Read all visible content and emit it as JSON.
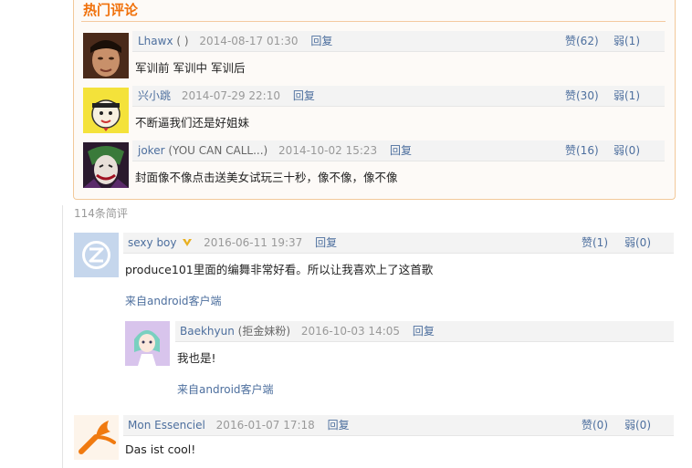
{
  "hot": {
    "title": "热门评论",
    "comments": [
      {
        "user": "Lhawx",
        "extra": "( )",
        "time": "2014-08-17 01:30",
        "reply": "回复",
        "up": "赞(62)",
        "down": "弱(1)",
        "text": "军训前 军训中 军训后"
      },
      {
        "user": "兴小跳",
        "extra": "",
        "time": "2014-07-29 22:10",
        "reply": "回复",
        "up": "赞(30)",
        "down": "弱(1)",
        "text": "不断逼我们还是好姐妹"
      },
      {
        "user": "joker",
        "extra": "(YOU CAN CALL...)",
        "time": "2014-10-02 15:23",
        "reply": "回复",
        "up": "赞(16)",
        "down": "弱(0)",
        "text": "封面像不像点击送美女试玩三十秒，像不像，像不像"
      }
    ]
  },
  "list": {
    "count_label": "114条简评",
    "comments": [
      {
        "user": "sexy boy",
        "time": "2016-06-11 19:37",
        "reply": "回复",
        "up": "赞(1)",
        "down": "弱(0)",
        "text": "produce101里面的编舞非常好看。所以让我喜欢上了这首歌",
        "from": "来自android客户端"
      },
      {
        "user": "Baekhyun",
        "extra": "(拒金妹粉)",
        "time": "2016-10-03 14:05",
        "reply": "回复",
        "text": "我也是!",
        "from": "来自android客户端"
      },
      {
        "user": "Mon Essenciel",
        "time": "2016-01-07 17:18",
        "reply": "回复",
        "up": "赞(0)",
        "down": "弱(0)",
        "text": "Das ist cool!"
      }
    ]
  },
  "colors": {
    "accent": "#f0700a",
    "link": "#4d6f9e",
    "vip": "#e8b020"
  },
  "icons": {
    "vip_badge": "vip-badge-icon"
  }
}
